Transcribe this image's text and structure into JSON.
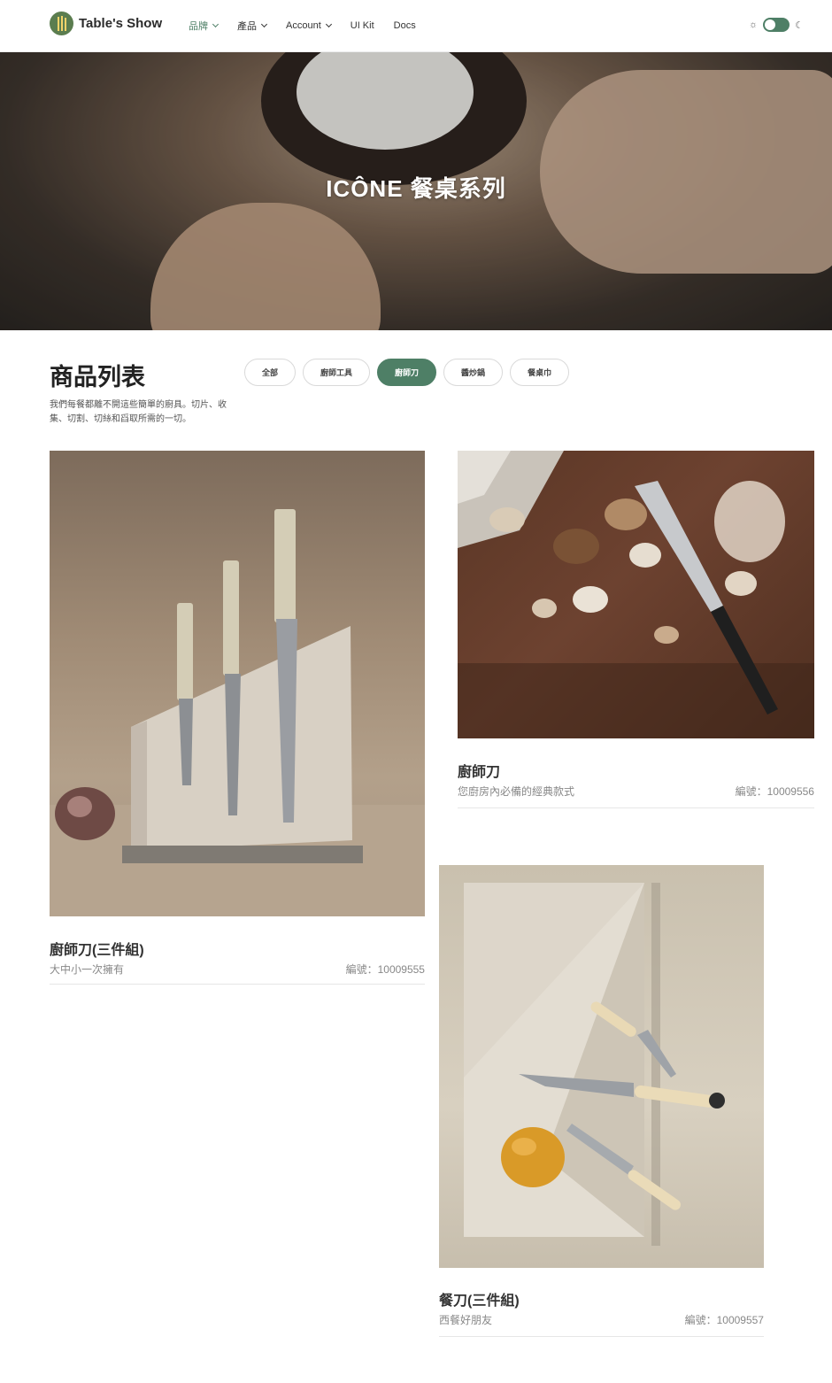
{
  "nav": {
    "brand": "Table's Show",
    "items": [
      {
        "label": "品牌",
        "dropdown": true,
        "active": true
      },
      {
        "label": "產品",
        "dropdown": true,
        "active": false
      },
      {
        "label": "Account",
        "dropdown": true,
        "active": false
      },
      {
        "label": "UI Kit",
        "dropdown": false,
        "active": false
      },
      {
        "label": "Docs",
        "dropdown": false,
        "active": false
      }
    ],
    "theme_toggle_on": true
  },
  "hero": {
    "title": "ICÔNE 餐桌系列"
  },
  "list": {
    "title": "商品列表",
    "description": "我們每餐都離不開這些簡單的廚具。切片、收集、切割、切絲和舀取所需的一切。",
    "filters": [
      {
        "label": "全部",
        "active": false
      },
      {
        "label": "廚師工具",
        "active": false
      },
      {
        "label": "廚師刀",
        "active": true
      },
      {
        "label": "醬炒鍋",
        "active": false
      },
      {
        "label": "餐桌巾",
        "active": false
      }
    ]
  },
  "products": [
    {
      "name": "廚師刀(三件組)",
      "subtitle": "大中小一次擁有",
      "code": "編號：10009555",
      "image": "knife-block-photo"
    },
    {
      "name": "廚師刀",
      "subtitle": "您廚房內必備的經典款式",
      "code": "編號：10009556",
      "image": "chef-knife-mushrooms-photo"
    },
    {
      "name": "餐刀(三件組)",
      "subtitle": "西餐好朋友",
      "code": "編號：10009557",
      "image": "knives-stone-board-photo"
    }
  ],
  "colors": {
    "accent": "#4e7f66",
    "text": "#222222",
    "muted": "#888888"
  }
}
